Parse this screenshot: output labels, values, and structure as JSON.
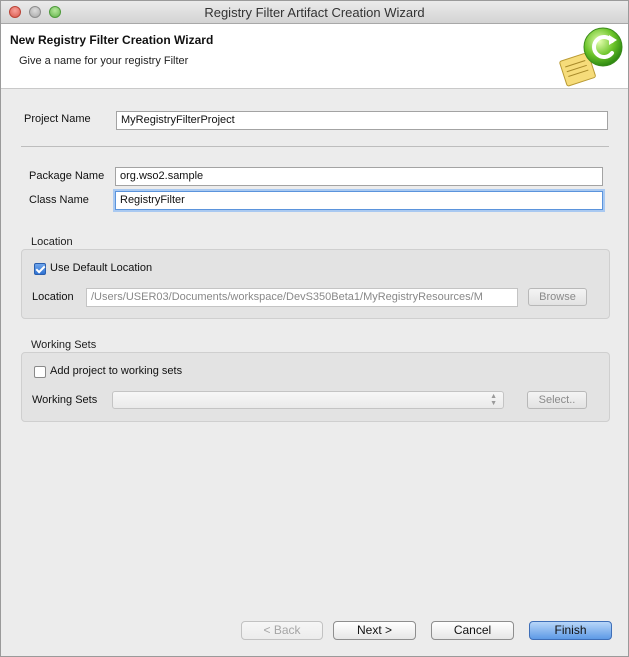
{
  "window": {
    "title": "Registry Filter Artifact Creation Wizard"
  },
  "banner": {
    "title": "New Registry Filter Creation Wizard",
    "subtitle": "Give a name for your registry Filter",
    "graphic": "wizard-graphic-icon"
  },
  "form": {
    "project_name_label": "Project Name",
    "project_name_value": "MyRegistryFilterProject",
    "package_name_label": "Package Name",
    "package_name_value": "org.wso2.sample",
    "class_name_label": "Class Name",
    "class_name_value": "RegistryFilter"
  },
  "location": {
    "title": "Location",
    "use_default_label": "Use Default Location",
    "use_default_checked": true,
    "location_label": "Location",
    "location_value": "/Users/USER03/Documents/workspace/DevS350Beta1/MyRegistryResources/M",
    "browse_label": "Browse"
  },
  "working_sets": {
    "title": "Working Sets",
    "add_label": "Add project to working sets",
    "add_checked": false,
    "sets_label": "Working Sets",
    "sets_value": "",
    "select_label": "Select.."
  },
  "footer": {
    "back_label": "< Back",
    "next_label": "Next >",
    "cancel_label": "Cancel",
    "finish_label": "Finish"
  },
  "colors": {
    "accent": "#5e9ae6",
    "window_bg": "#ececec"
  }
}
